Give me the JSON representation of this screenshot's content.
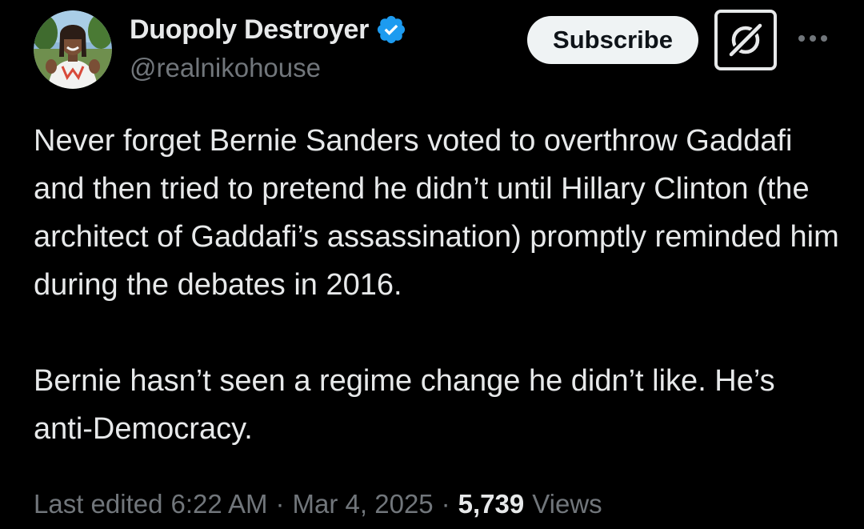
{
  "author": {
    "display_name": "Duopoly Destroyer",
    "handle": "@realnikohouse",
    "verified": true
  },
  "actions": {
    "subscribe_label": "Subscribe",
    "grok_icon": "grok-icon",
    "more_icon": "more-icon"
  },
  "tweet": {
    "paragraphs": [
      "Never forget Bernie Sanders voted to overthrow Gaddafi and then tried to pretend he didn’t until Hillary Clinton (the architect of Gaddafi’s assassination) promptly reminded him during the debates in 2016.",
      "Bernie hasn’t seen a regime change he didn’t like. He’s anti-Democracy."
    ]
  },
  "meta": {
    "edited_label": "Last edited",
    "time": "6:22 AM",
    "separator": "·",
    "date": "Mar 4, 2025",
    "views_count": "5,739",
    "views_label": "Views"
  },
  "colors": {
    "background": "#000000",
    "text_primary": "#e7e9ea",
    "text_secondary": "#71767b",
    "verified_badge": "#1d9bf0",
    "subscribe_bg": "#eff3f4"
  }
}
